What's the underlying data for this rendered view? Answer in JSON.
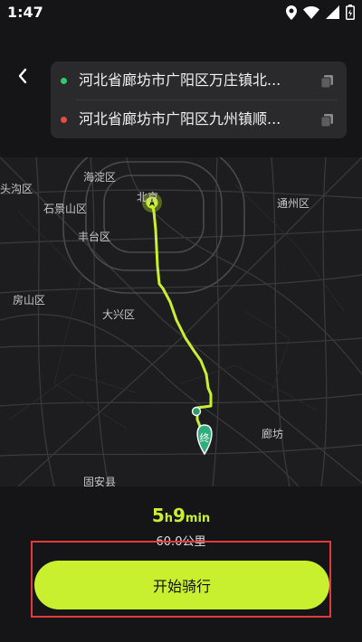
{
  "status_bar": {
    "time": "1:47",
    "icons": [
      "location-icon",
      "wifi-icon",
      "signal-icon",
      "battery-icon"
    ]
  },
  "header": {
    "back_icon": "chevron-left-icon"
  },
  "route": {
    "start_address": "河北省廊坊市广阳区万庄镇北...",
    "end_address": "河北省廊坊市广阳区九州镇顺...",
    "start_color": "#2ecc71",
    "end_color": "#e74c3c",
    "copy_icon": "copy-icon"
  },
  "map": {
    "labels": {
      "haidian": "海淀区",
      "beijing": "北京",
      "tongzhou": "通州区",
      "shijingshan": "石景山区",
      "fengtai": "丰台区",
      "fangshan": "房山区",
      "daxing": "大兴区",
      "langfang": "廊坊",
      "guan": "固安县",
      "toutou": "头沟区"
    },
    "end_marker_label": "终",
    "route_color": "#c9f02e"
  },
  "summary": {
    "hours": "5",
    "hours_unit": "h",
    "minutes": "9",
    "minutes_unit": "min",
    "distance": "60.0公里"
  },
  "action": {
    "start_label": "开始骑行",
    "accent": "#c9f02e",
    "highlight_color": "#e23b3b"
  }
}
